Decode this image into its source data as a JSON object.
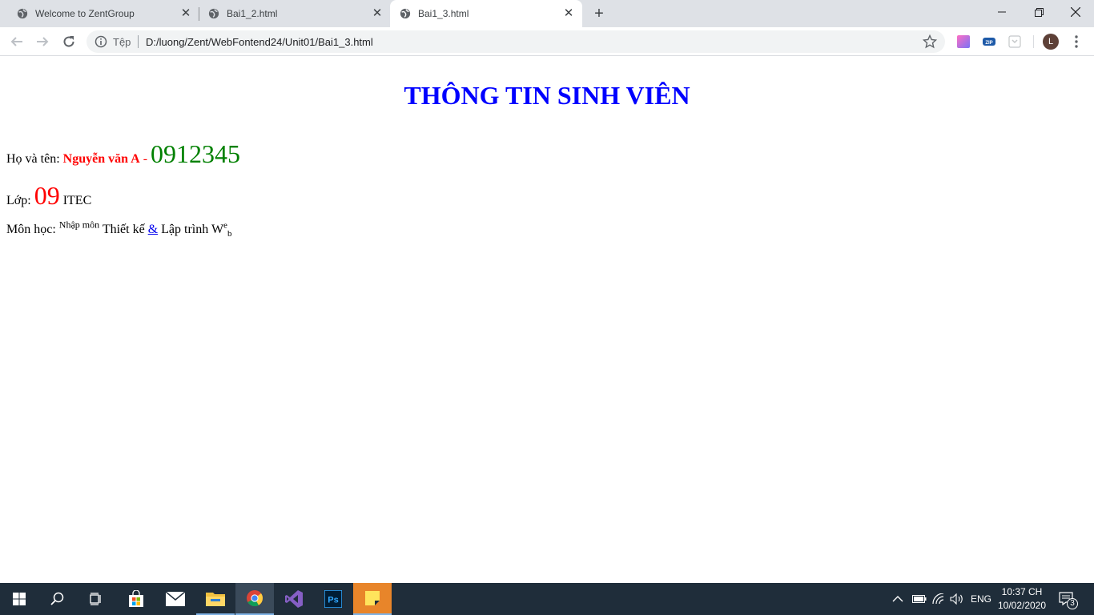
{
  "browser": {
    "tabs": [
      {
        "title": "Welcome to ZentGroup",
        "active": false
      },
      {
        "title": "Bai1_2.html",
        "active": false
      },
      {
        "title": "Bai1_3.html",
        "active": true
      }
    ],
    "new_tab_label": "+",
    "omnibox": {
      "scheme_label": "Tệp",
      "url": "D:/luong/Zent/WebFontend24/Unit01/Bai1_3.html"
    },
    "extensions": [
      "gradient-extension-icon",
      "zip-extension-icon",
      "pocket-extension-icon"
    ],
    "profile_initial": "L"
  },
  "page": {
    "heading": "THÔNG TIN SINH VIÊN",
    "name_row": {
      "label": "Họ và tên: ",
      "name": "Nguyễn văn A",
      "separator": " - ",
      "phone": "0912345"
    },
    "class_row": {
      "label": "Lớp: ",
      "number": "09",
      "suffix": " ITEC"
    },
    "subject_row": {
      "label": "Môn học: ",
      "intro_sup": "Nhập môn",
      "part1": " Thiết kế ",
      "ampersand": "&",
      "part2": " Lập trình W",
      "e_sup": "e",
      "b_sub": "b"
    }
  },
  "taskbar": {
    "apps": [
      "windows-start",
      "search",
      "task-view",
      "store",
      "mail",
      "file-explorer",
      "chrome",
      "visual-studio",
      "photoshop",
      "sticky-notes"
    ],
    "tray": {
      "language": "ENG",
      "time": "10:37 CH",
      "date": "10/02/2020",
      "notification_count": "3"
    }
  },
  "colors": {
    "heading": "#0000ff",
    "name": "#ff0000",
    "phone": "#008000",
    "class_number": "#ff0000",
    "link": "#0000ee"
  }
}
